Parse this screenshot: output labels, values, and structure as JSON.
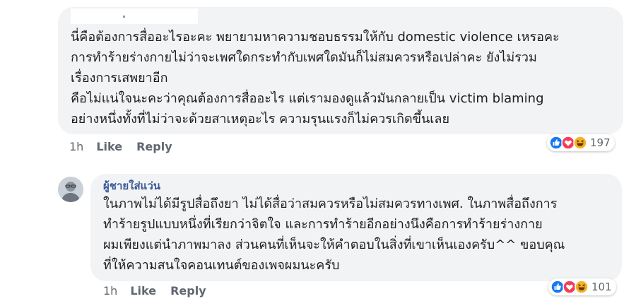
{
  "comment1": {
    "lines": [
      "นี่คือต้องการสื่ออะไรอะคะ พยายามหาความชอบธรรมให้กับ domestic violence เหรอคะ",
      "การทำร้ายร่างกายไม่ว่าจะเพศใดกระทำกับเพศใดมันก็ไม่สมควรหรือเปล่าคะ ยังไม่รวม",
      "เรื่องการเสพยาอีก",
      "คือไม่แน่ใจนะคะว่าคุณต้องการสื่ออะไร แต่เรามองดูแล้วมันกลายเป็น victim blaming",
      "อย่างหนึ่งทั้งที่ไม่ว่าจะด้วยสาเหตุอะไร ความรุนแรงก็ไม่ควรเกิดขึ้นเลย"
    ],
    "time": "1h",
    "like_label": "Like",
    "reply_label": "Reply",
    "reaction_count": "197",
    "reaction_icons": [
      "like-icon",
      "love-icon",
      "haha-icon"
    ]
  },
  "comment2": {
    "author": "ผู้ชายใส่แว่น",
    "lines": [
      "ในภาพไม่ได้มีรูปสื่อถึงยา ไม่ได้สื่อว่าสมควรหรือไม่สมควรทางเพศ. ในภาพสื่อถึงการ",
      "ทำร้ายรูปแบบหนึ่งที่เรียกว่าจิตใจ และการทำร้ายอีกอย่างนึงคือการทำร้ายร่างกาย",
      "ผมเพียงแต่นำภาพมาลง ส่วนคนที่เห็นจะให้คำตอบในสิ่งที่เขาเห็นเองครับ^^ ขอบคุณ",
      "ที่ให้ความสนใจคอนเทนต์ของเพจผมนะครับ"
    ],
    "time": "1h",
    "like_label": "Like",
    "reply_label": "Reply",
    "reaction_count": "101",
    "reaction_icons": [
      "like-icon",
      "love-icon",
      "haha-icon"
    ]
  },
  "colors": {
    "bubble_bg": "#f2f3f5",
    "author_link": "#385898",
    "meta_text": "#606770",
    "like_blue": "#1877f2",
    "love_red": "#f33e58",
    "haha_yellow": "#f7b125"
  }
}
